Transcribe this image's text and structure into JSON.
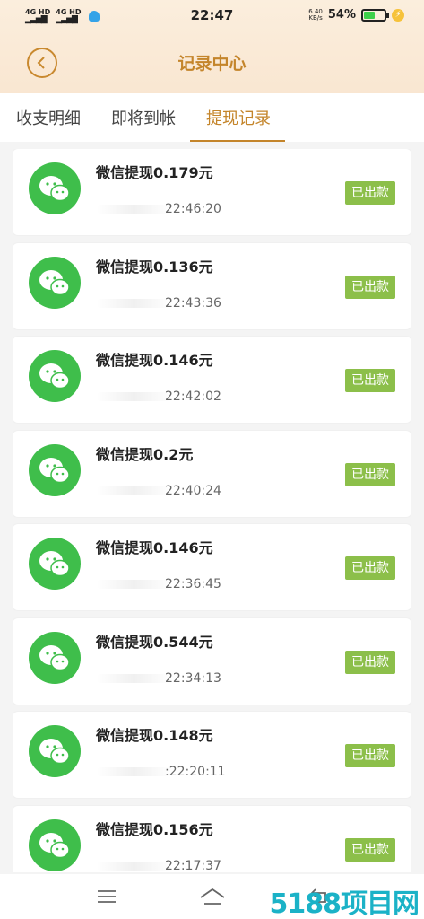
{
  "status_bar": {
    "signal_1": "4G HD",
    "signal_2": "4G HD",
    "time": "22:47",
    "net_speed_value": "6.40",
    "net_speed_unit": "KB/s",
    "battery_percent": "54%",
    "battery_level": 0.54
  },
  "header": {
    "title": "记录中心"
  },
  "tabs": [
    {
      "label": "收支明细",
      "active": false
    },
    {
      "label": "即将到帐",
      "active": false
    },
    {
      "label": "提现记录",
      "active": true
    }
  ],
  "records": [
    {
      "title": "微信提现0.179元",
      "time": "22:46:20",
      "status": "已出款"
    },
    {
      "title": "微信提现0.136元",
      "time": "22:43:36",
      "status": "已出款"
    },
    {
      "title": "微信提现0.146元",
      "time": "22:42:02",
      "status": "已出款"
    },
    {
      "title": "微信提现0.2元",
      "time": "22:40:24",
      "status": "已出款"
    },
    {
      "title": "微信提现0.146元",
      "time": "22:36:45",
      "status": "已出款"
    },
    {
      "title": "微信提现0.544元",
      "time": "22:34:13",
      "status": "已出款"
    },
    {
      "title": "微信提现0.148元",
      "time": ":22:20:11",
      "status": "已出款"
    },
    {
      "title": "微信提现0.156元",
      "time": "22:17:37",
      "status": "已出款"
    }
  ],
  "watermark": "5188项目网",
  "colors": {
    "accent": "#c4852b",
    "wechat_green": "#3fbe4b",
    "badge_green": "#8cbf4a"
  },
  "icons": {
    "back": "back-arrow-icon",
    "record": "wechat-icon",
    "nav_menu": "menu-icon",
    "nav_home": "home-icon",
    "nav_back": "back-icon"
  }
}
